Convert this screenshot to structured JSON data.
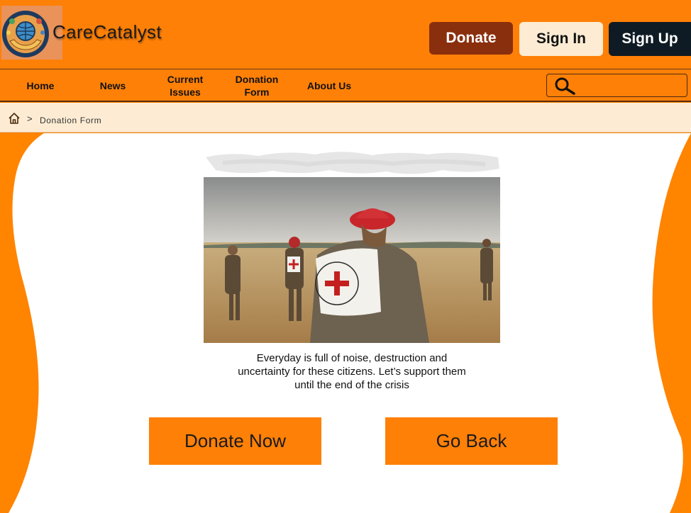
{
  "brand": {
    "name": "CareCatalyst"
  },
  "header": {
    "donate_label": "Donate",
    "signin_label": "Sign In",
    "signup_label": "Sign Up"
  },
  "nav": {
    "items": [
      {
        "label": "Home"
      },
      {
        "label": "News"
      },
      {
        "label": "Current Issues"
      },
      {
        "label": "Donation Form"
      },
      {
        "label": "About Us"
      }
    ],
    "search_placeholder": ""
  },
  "breadcrumb": {
    "current": "Donation Form",
    "separator": ">"
  },
  "main": {
    "caption": "Everyday is full of noise, destruction and uncertainty for these citizens. Let’s support them until the end of the crisis",
    "donate_now_label": "Donate Now",
    "go_back_label": "Go Back"
  },
  "icons": {
    "logo": "globe-hands-logo-icon",
    "search": "search-icon",
    "home": "home-icon"
  },
  "colors": {
    "accent": "#ff8007",
    "donate_button": "#8a2f0d",
    "signin_button": "#fdecd3",
    "signup_button": "#0f1b24",
    "breadcrumb_bg": "#fdecd3"
  }
}
